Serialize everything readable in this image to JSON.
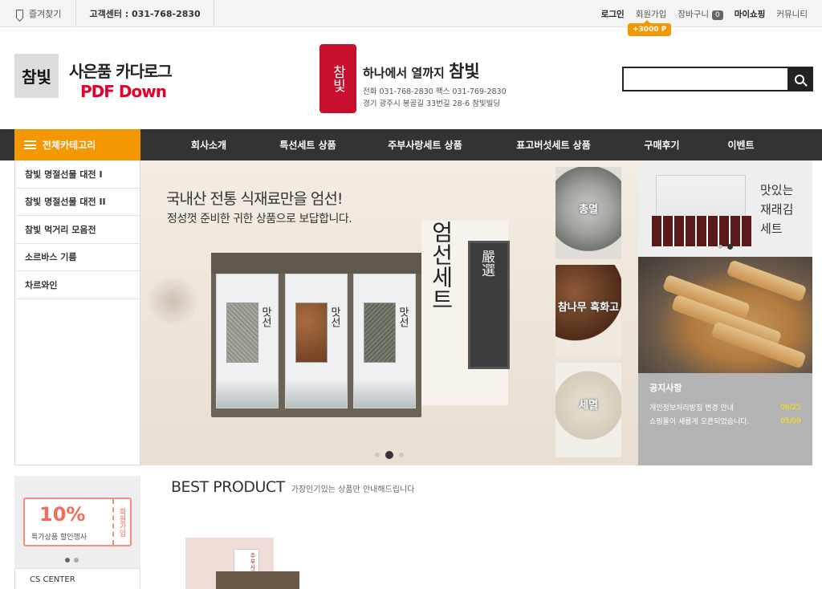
{
  "topbar": {
    "favorites_label": "즐겨찾기",
    "cs_label": "고객센터 : 031-768-2830",
    "login": "로그인",
    "join": "회원가입",
    "join_bonus": "+3000 P",
    "cart": "장바구니",
    "cart_count": "0",
    "mypage": "마이쇼핑",
    "community": "커뮤니티"
  },
  "header": {
    "catalog_logo": "참빛",
    "catalog_title": "사은품 카다로그",
    "catalog_pdf": "PDF Down",
    "seal_text": "참빛",
    "tagline_prefix": "하나에서 열까지",
    "tagline_brand": "참빛",
    "contact": "전화 031-768-2830 팩스 031-769-2830",
    "address": "경기 광주시 봉골길 33번길 28-6 참빛빌딩",
    "search_placeholder": ""
  },
  "nav": {
    "all_categories": "전체카테고리",
    "items": [
      "회사소개",
      "특선세트 상품",
      "주부사랑세트 상품",
      "표고버섯세트 상품",
      "구매후기",
      "이벤트"
    ]
  },
  "categories": [
    "참빛 명절선물 대전 I",
    "참빛 명절선물 대전 II",
    "참빛 먹거리 모음전",
    "소르바스 기름",
    "차르와인"
  ],
  "banner": {
    "headline": "국내산 전통 식재료만을 엄선!",
    "subline": "정성껏 준비한 귀한 상품으로 보답합니다.",
    "set_title": "엄선세트",
    "seal_title": "嚴選",
    "card_label": "맛선",
    "photo1": "총멸",
    "photo2": "참나무 흑화고",
    "photo3": "세멸"
  },
  "side_ad": {
    "text_line1": "맛있는",
    "text_line2": "재래김",
    "text_line3": "세트"
  },
  "notice": {
    "title": "공지사항",
    "items": [
      {
        "text": "개인정보처리방침 변경 안내",
        "date": "06/25"
      },
      {
        "text": "쇼핑몰이 새롭게 오픈되었습니다.",
        "date": "05/09"
      }
    ]
  },
  "promo": {
    "percent": "10%",
    "text": "특가상품 할인행사",
    "stamp": "회원가입"
  },
  "cs_center": "CS CENTER",
  "best": {
    "title": "BEST PRODUCT",
    "subtitle": "가장인기있는 상품만 안내해드립니다",
    "product_label": "주부사랑"
  },
  "colors": {
    "accent": "#f39800",
    "nav_bg": "#333333",
    "brand_red": "#c8102e",
    "notice_date": "#ffe600"
  }
}
